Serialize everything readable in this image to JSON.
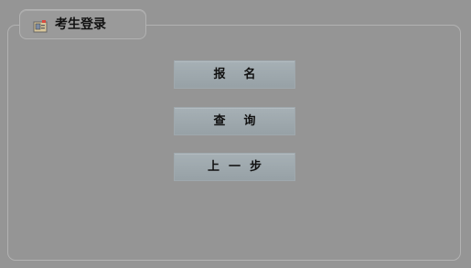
{
  "panel": {
    "title": "考生登录",
    "icon": "id-card-icon"
  },
  "buttons": {
    "register": "报名",
    "query": "查询",
    "previous": "上一步"
  },
  "colors": {
    "background": "#959595",
    "button": "#9fa8ad",
    "border": "#b2b2b2"
  }
}
